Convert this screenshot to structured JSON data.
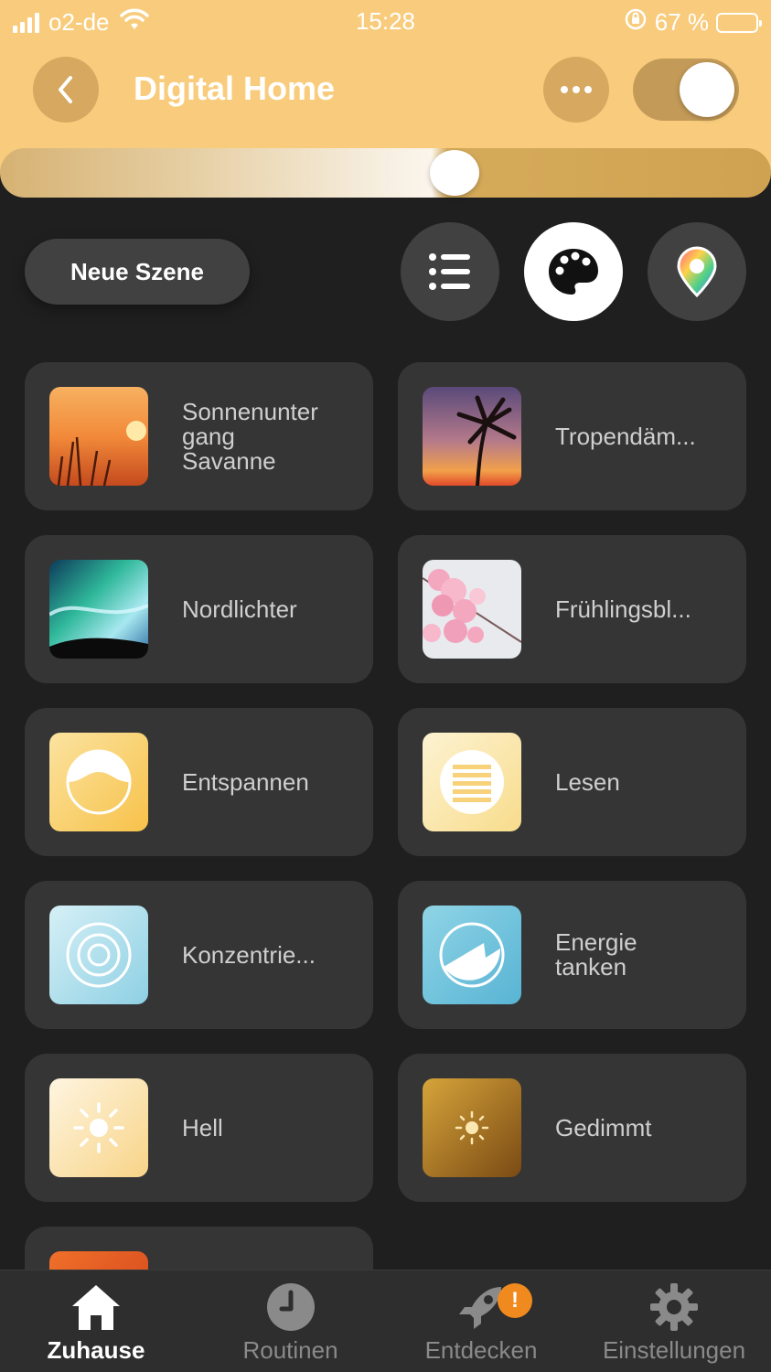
{
  "status": {
    "carrier": "o2-de",
    "time": "15:28",
    "battery": "67 %"
  },
  "header": {
    "title": "Digital Home",
    "power_on": true,
    "brightness": 0.59
  },
  "actions": {
    "new_scene_label": "Neue Szene"
  },
  "scenes": [
    {
      "label": "Sonnenunter\ngang\nSavanne",
      "icon": "savanna-sunset-image"
    },
    {
      "label": "Tropendäm...",
      "icon": "tropical-twilight-image"
    },
    {
      "label": "Nordlichter",
      "icon": "northern-lights-image"
    },
    {
      "label": "Frühlingsbl...",
      "icon": "spring-blossom-image"
    },
    {
      "label": "Entspannen",
      "icon": "relax-icon"
    },
    {
      "label": "Lesen",
      "icon": "read-icon"
    },
    {
      "label": "Konzentrie...",
      "icon": "concentrate-icon"
    },
    {
      "label": "Energie\ntanken",
      "icon": "energize-icon"
    },
    {
      "label": "Hell",
      "icon": "bright-icon"
    },
    {
      "label": "Gedimmt",
      "icon": "dimmed-icon"
    }
  ],
  "tabs": [
    {
      "label": "Zuhause",
      "icon": "home-icon",
      "active": true
    },
    {
      "label": "Routinen",
      "icon": "clock-icon",
      "active": false
    },
    {
      "label": "Entdecken",
      "icon": "rocket-icon",
      "active": false,
      "badge": "!"
    },
    {
      "label": "Einstellungen",
      "icon": "gear-icon",
      "active": false
    }
  ],
  "colors": {
    "accent": "#f8cc7c",
    "background": "#1f1f1f",
    "card": "#353535",
    "badge": "#f08a1e"
  }
}
